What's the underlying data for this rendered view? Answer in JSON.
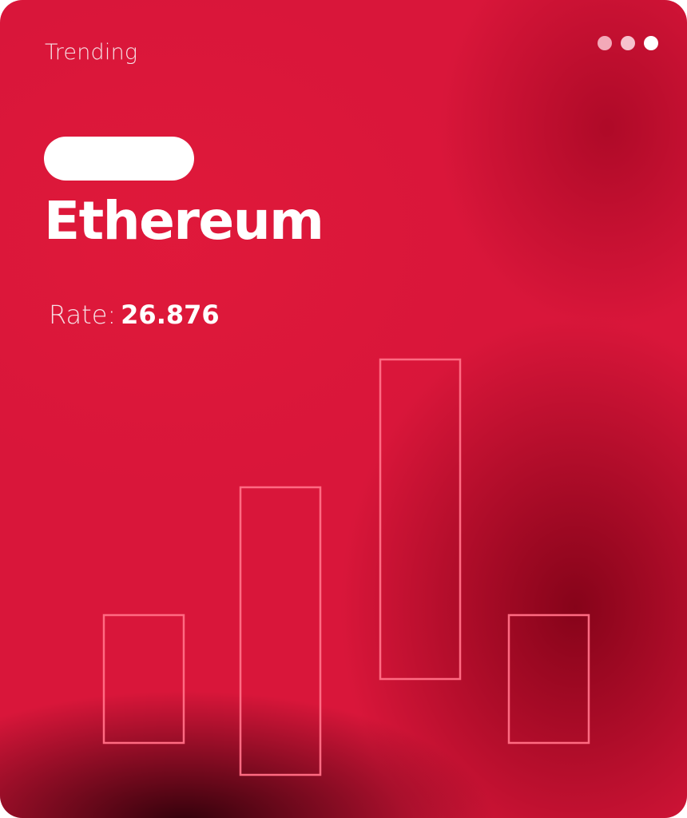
{
  "card": {
    "label": "Trending",
    "title": "Ethereum",
    "rate_label": "Rate:",
    "rate_value": "26.876",
    "menu_icon": "more-dots-icon"
  },
  "colors": {
    "background": "#d9163a",
    "dark_glow": "#7a0014",
    "bar_outline": "#ff6b82",
    "text": "#ffffff"
  },
  "chart_data": {
    "type": "bar",
    "categories": [],
    "values": [
      4,
      9,
      10,
      4
    ],
    "baselines": [
      0,
      -1,
      2,
      0
    ],
    "ylim": [
      -2,
      13
    ],
    "grid": false,
    "legend": "none"
  }
}
